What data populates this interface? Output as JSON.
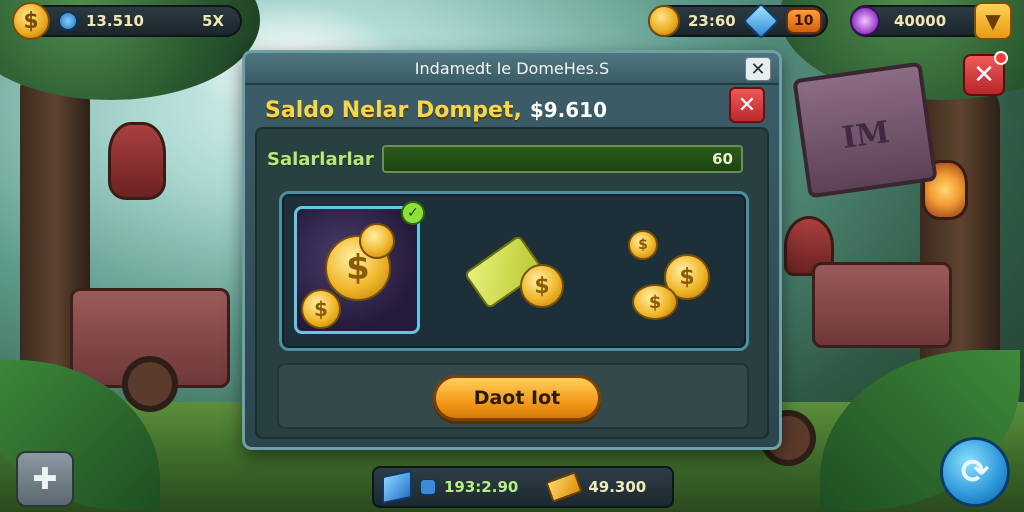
{
  "hud": {
    "coins": {
      "icon": "dollar-coin-icon",
      "glyph": "$",
      "value": "13.510",
      "multiplier": "5X"
    },
    "gold": {
      "icon": "gold-coin-icon",
      "value": "23:60"
    },
    "gems": {
      "icon": "diamond-icon",
      "badge": "10"
    },
    "energy": {
      "icon": "purple-swirl-icon",
      "value": "40000"
    }
  },
  "modal": {
    "title": "Indamedt Ie DomeHes.S",
    "close_top": "✕",
    "balance_label": "Saldo Nelar Dompet,",
    "balance_amount": "$9.610",
    "close_red": "✕",
    "salary_label": "Salarlarlar",
    "salary_value": "60",
    "salary_progress": 1.0,
    "items": [
      {
        "name": "coin-pile",
        "selected": true,
        "glyph": "$"
      },
      {
        "name": "cash-and-coin",
        "selected": false,
        "glyph": "$"
      },
      {
        "name": "scattered-coins",
        "selected": false,
        "glyph": "$"
      }
    ],
    "check_glyph": "✓",
    "claim_label": "Daot Iot"
  },
  "bottom": {
    "gems_value": "193:2.90",
    "gold_value": "49.300"
  },
  "buttons": {
    "corner_close": "✕",
    "left_glyph": "✚",
    "right_glyph": "⟳"
  },
  "colors": {
    "accent_gold": "#f6d74c",
    "modal_bg": "#2a454e",
    "close_red": "#bb2a2e",
    "claim_orange": "#f39a1a"
  }
}
